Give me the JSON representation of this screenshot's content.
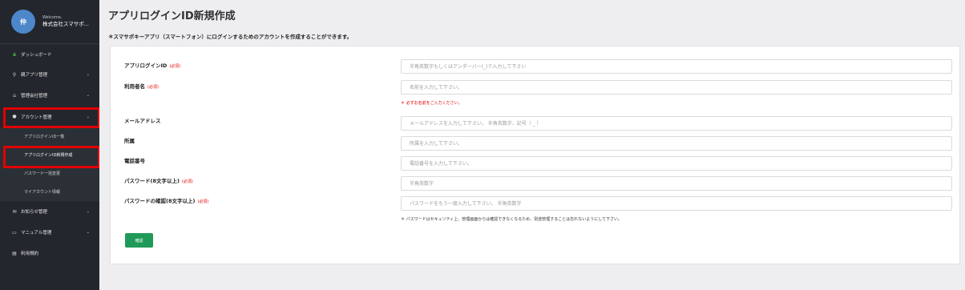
{
  "sidebar": {
    "avatar_initial": "仲",
    "welcome": "Welcome,",
    "company": "株式会社スマサポ...",
    "dashboard": "ダッシュボード",
    "items": [
      {
        "label": "親アプリ管理",
        "icon": "key-icon"
      },
      {
        "label": "管理会社管理",
        "icon": "home-icon"
      },
      {
        "label": "アカウント管理",
        "icon": "user-icon"
      }
    ],
    "sub_items": [
      {
        "label": "アプリログインID一覧"
      },
      {
        "label": "アプリログインID新規作成"
      },
      {
        "label": "パスワード一括変更"
      },
      {
        "label": "マイアカウント情報"
      }
    ],
    "bottom_items": [
      {
        "label": "お知らせ管理",
        "icon": "mail-icon"
      },
      {
        "label": "マニュアル管理",
        "icon": "inbox-icon"
      },
      {
        "label": "利用規約",
        "icon": "document-icon"
      }
    ]
  },
  "main": {
    "title": "アプリログインID新規作成",
    "description": "＊スマサポキーアプリ（スマートフォン）にログインするためのアカウントを作成することができます。",
    "required_tag": "(必須)",
    "fields": [
      {
        "label": "アプリログインID",
        "required": true,
        "placeholder": "半角英数字もしくはアンダーバー(_)で入力して下さい"
      },
      {
        "label": "利用者名",
        "required": true,
        "placeholder": "名前を入力して下さい。",
        "error": "＊ 必ずお名前をご入力ください。"
      },
      {
        "label": "メールアドレス",
        "required": false,
        "placeholder": "メールアドレスを入力して下さい。 半角英数字、記号（ _ ）"
      },
      {
        "label": "所属",
        "required": false,
        "placeholder": "所属を入力して下さい。"
      },
      {
        "label": "電話番号",
        "required": false,
        "placeholder": "電話番号を入力して下さい。"
      },
      {
        "label": "パスワード(8文字以上)",
        "required": true,
        "placeholder": "半角英数字"
      },
      {
        "label": "パスワードの確認(8文字以上)",
        "required": true,
        "placeholder": "パスワードをもう一度入力して下さい。 半角英数字",
        "note": "＊ パスワードはセキュリティ上、管理画面からは確認できなくなるため、別途管理することは忘れないようにして下さい。"
      }
    ],
    "confirm_label": "確認"
  }
}
